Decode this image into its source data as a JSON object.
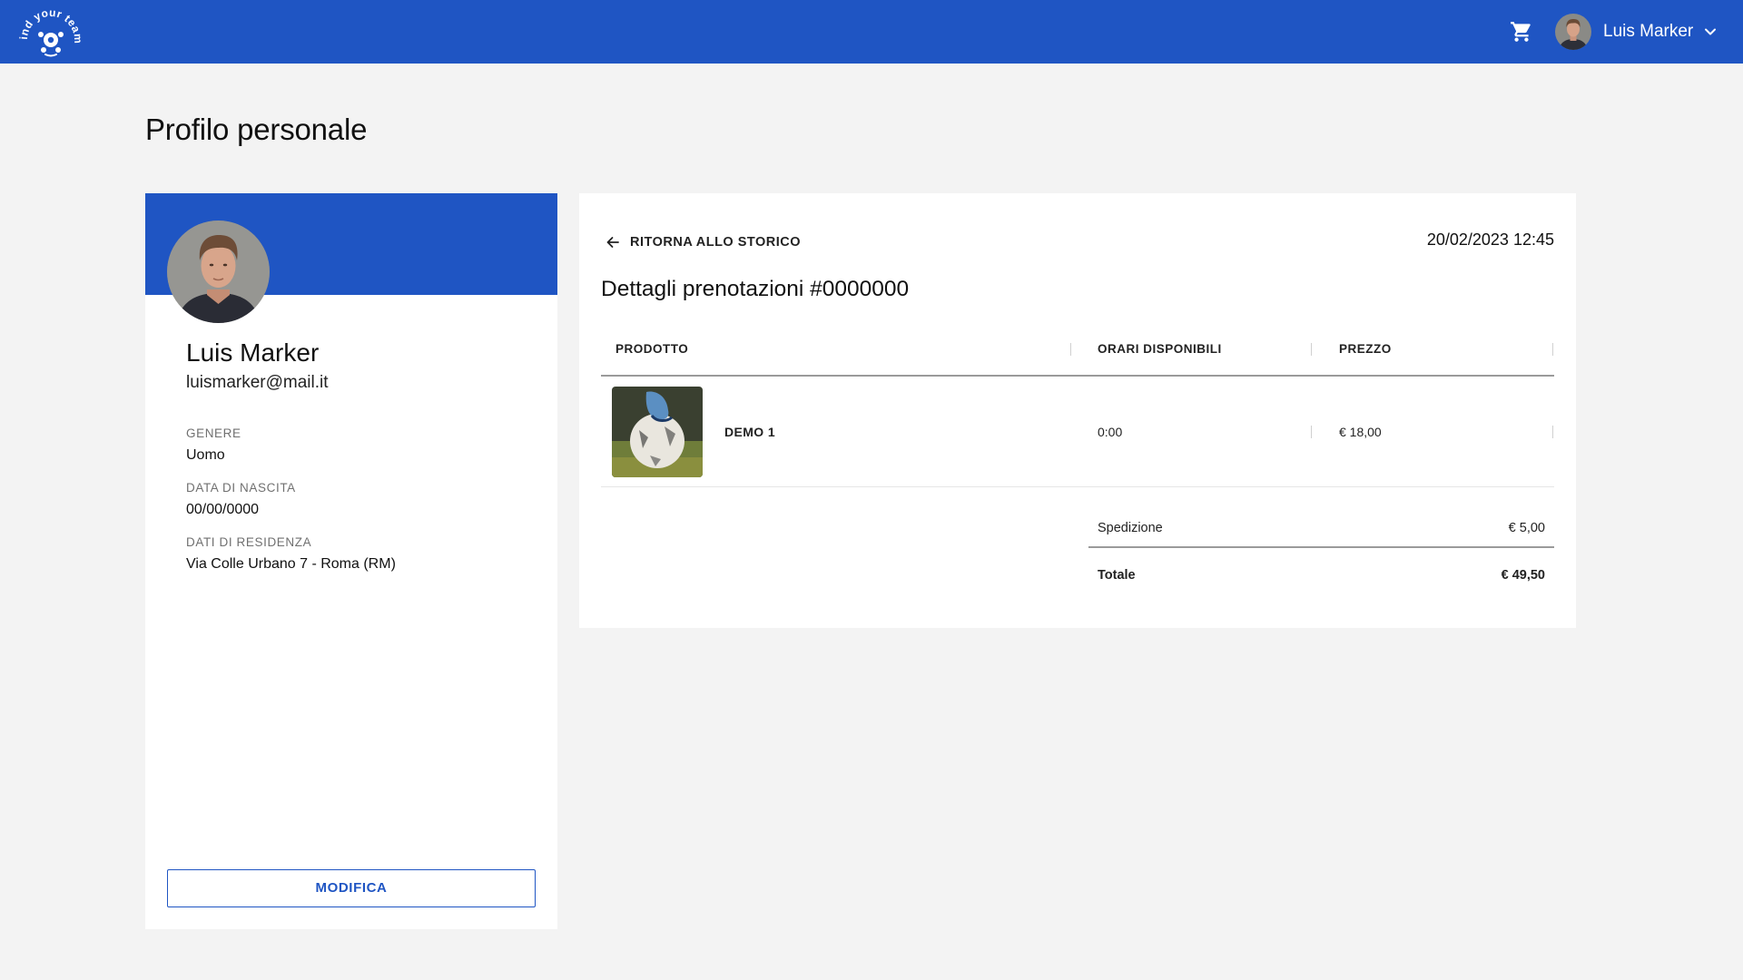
{
  "header": {
    "logo_text": "find your team",
    "user_name": "Luis Marker",
    "icons": {
      "cart": "shopping-cart-icon",
      "dropdown": "chevron-down-icon"
    }
  },
  "page": {
    "title": "Profilo personale"
  },
  "profile": {
    "name": "Luis Marker",
    "email": "luismarker@mail.it",
    "fields": [
      {
        "label": "GENERE",
        "value": "Uomo"
      },
      {
        "label": "DATA DI NASCITA",
        "value": "00/00/0000"
      },
      {
        "label": "DATI DI RESIDENZA",
        "value": "Via Colle Urbano 7 - Roma (RM)"
      }
    ],
    "edit_label": "MODIFICA"
  },
  "order": {
    "back_label": "RITORNA ALLO STORICO",
    "date": "20/02/2023 12:45",
    "title": "Dettagli prenotazioni #0000000",
    "columns": [
      "PRODOTTO",
      "ORARI DISPONIBILI",
      "PREZZO"
    ],
    "items": [
      {
        "product": "DEMO 1",
        "time": "0:00",
        "price": "€ 18,00"
      }
    ],
    "shipping_label": "Spedizione",
    "shipping_value": "€ 5,00",
    "total_label": "Totale",
    "total_value": "€ 49,50"
  },
  "colors": {
    "brand": "#1f55c3",
    "background": "#f3f3f3"
  }
}
